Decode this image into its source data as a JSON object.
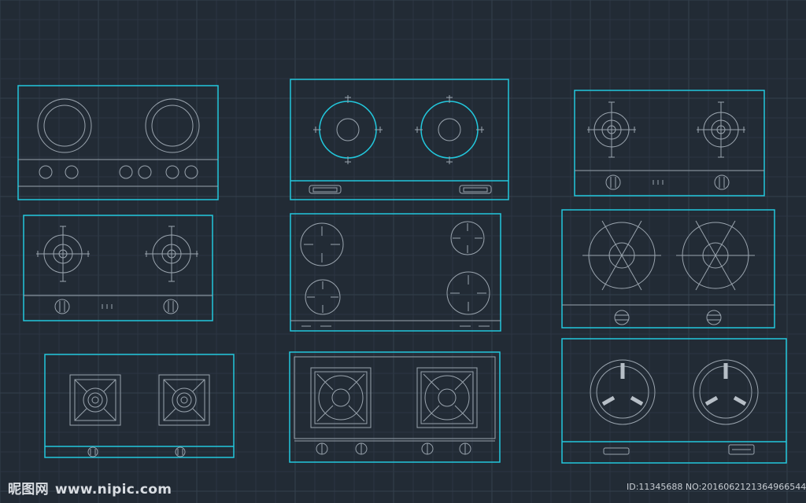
{
  "watermark": {
    "logo": "昵图网",
    "site": "www.nipic.com"
  },
  "image_id": "ID:11345688 NO:20160621213649665448",
  "colors": {
    "background": "#222b35",
    "grid_minor": "#2c3642",
    "grid_major": "#34404d",
    "frame": "#22c8dd",
    "lines": "#9aa4ae",
    "cyan_burner": "#22c8dd"
  }
}
